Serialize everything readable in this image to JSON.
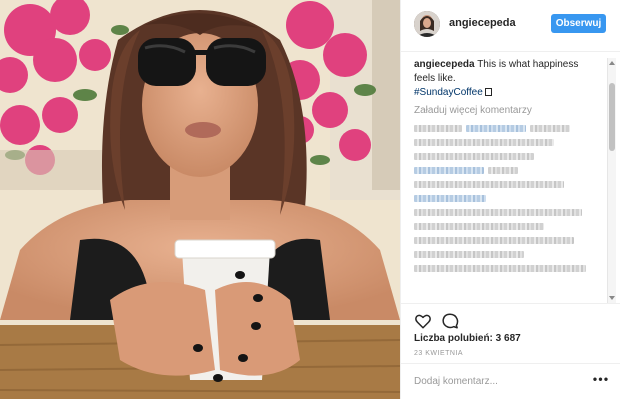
{
  "post": {
    "username": "angiecepeda",
    "follow_label": "Obserwuj",
    "caption_user": "angiecepeda",
    "caption_text": " This is what happiness feels like.",
    "hashtag": "#SundayCoffee",
    "load_more_label": "Załaduj więcej komentarzy",
    "likes_text": "Liczba polubień: 3 687",
    "date": "23 KWIETNIA",
    "comment_placeholder": "Dodaj komentarz..."
  },
  "icons": {
    "like": "heart-icon",
    "comment": "speech-bubble-icon",
    "more": "more-options-icon",
    "avatar": "profile-avatar"
  },
  "colors": {
    "follow_button": "#3897f0",
    "hashtag": "#003569",
    "muted_text": "#999999"
  }
}
